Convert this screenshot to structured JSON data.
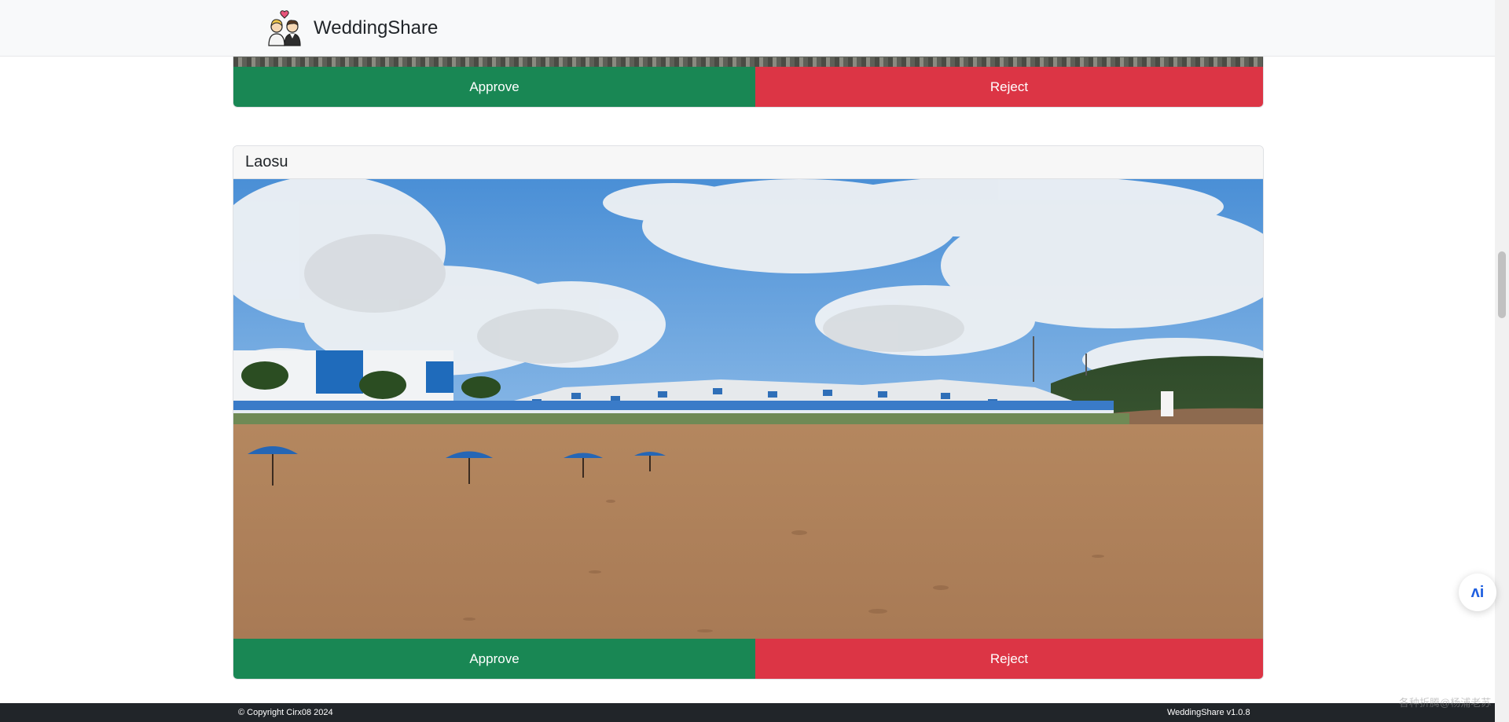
{
  "app": {
    "name": "WeddingShare",
    "logo_icon": "couple-icon"
  },
  "gallery": {
    "previous_item": {
      "approve_label": "Approve",
      "reject_label": "Reject"
    },
    "items": [
      {
        "uploader": "Laosu",
        "approve_label": "Approve",
        "reject_label": "Reject",
        "photo_description": "beach-resort-photo"
      }
    ]
  },
  "footer": {
    "copyright": "© Copyright Cirx08 2024",
    "version": "WeddingShare v1.0.8"
  },
  "floating_widget": {
    "icon": "assistant-icon",
    "glyph": "ʌi"
  },
  "watermark": "各种折腾@杨浦老苏",
  "colors": {
    "approve": "#198754",
    "reject": "#dc3545",
    "navbar": "#f8f9fa",
    "footer": "#212529"
  }
}
